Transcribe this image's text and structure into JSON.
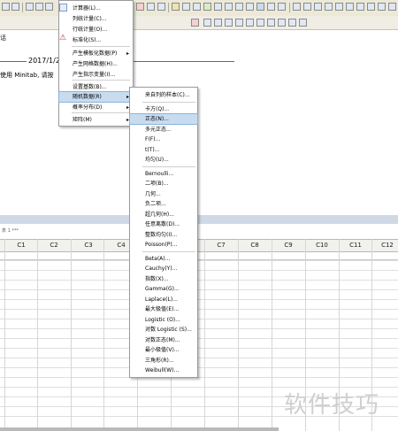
{
  "session": {
    "title": "话",
    "date": "2017/1/2",
    "text": "使用 Minitab, 请按"
  },
  "worksheet": {
    "title": "表 1 ***",
    "columns": [
      "C1",
      "C2",
      "C3",
      "C4",
      "C7",
      "C8",
      "C9",
      "C10",
      "C11",
      "C12"
    ]
  },
  "calc_menu": {
    "items": [
      {
        "label": "计算器(L)...",
        "has_sub": false
      },
      {
        "label": "列统计量(C)...",
        "has_sub": false
      },
      {
        "label": "行统计量(O)...",
        "has_sub": false
      },
      {
        "label": "标准化(S)...",
        "has_sub": false
      },
      {
        "label": "产生模板化数据(P)",
        "has_sub": true
      },
      {
        "label": "产生网格数据(H)...",
        "has_sub": false
      },
      {
        "label": "产生指示变量(I)...",
        "has_sub": false
      },
      {
        "label": "设置基数(B)...",
        "has_sub": false
      },
      {
        "label": "随机数据(R)",
        "has_sub": true
      },
      {
        "label": "概率分布(D)",
        "has_sub": true
      },
      {
        "label": "矩阵(M)",
        "has_sub": true
      }
    ]
  },
  "random_menu": {
    "items": [
      "来自列的样本(C)...",
      "卡方(Q)...",
      "正态(N)...",
      "多元正态...",
      "F(F)...",
      "t(T)...",
      "均匀(U)...",
      "Bernoulli...",
      "二项(B)...",
      "几何...",
      "负二项...",
      "超几何(H)...",
      "任意离散(D)...",
      "整数均匀(I)...",
      "Poisson(P)...",
      "Beta(A)...",
      "Cauchy(Y)...",
      "指数(X)...",
      "Gamma(G)...",
      "Laplace(L)...",
      "最大极值(E)...",
      "Logistic (O)...",
      "对数 Logistic (S)...",
      "对数正态(M)...",
      "最小极值(V)...",
      "三角形(R)...",
      "Weibull(W)..."
    ]
  },
  "watermark": "软件技巧",
  "colors": {
    "highlight": "#c8dcf0",
    "menu_border": "#9a9a9a"
  }
}
